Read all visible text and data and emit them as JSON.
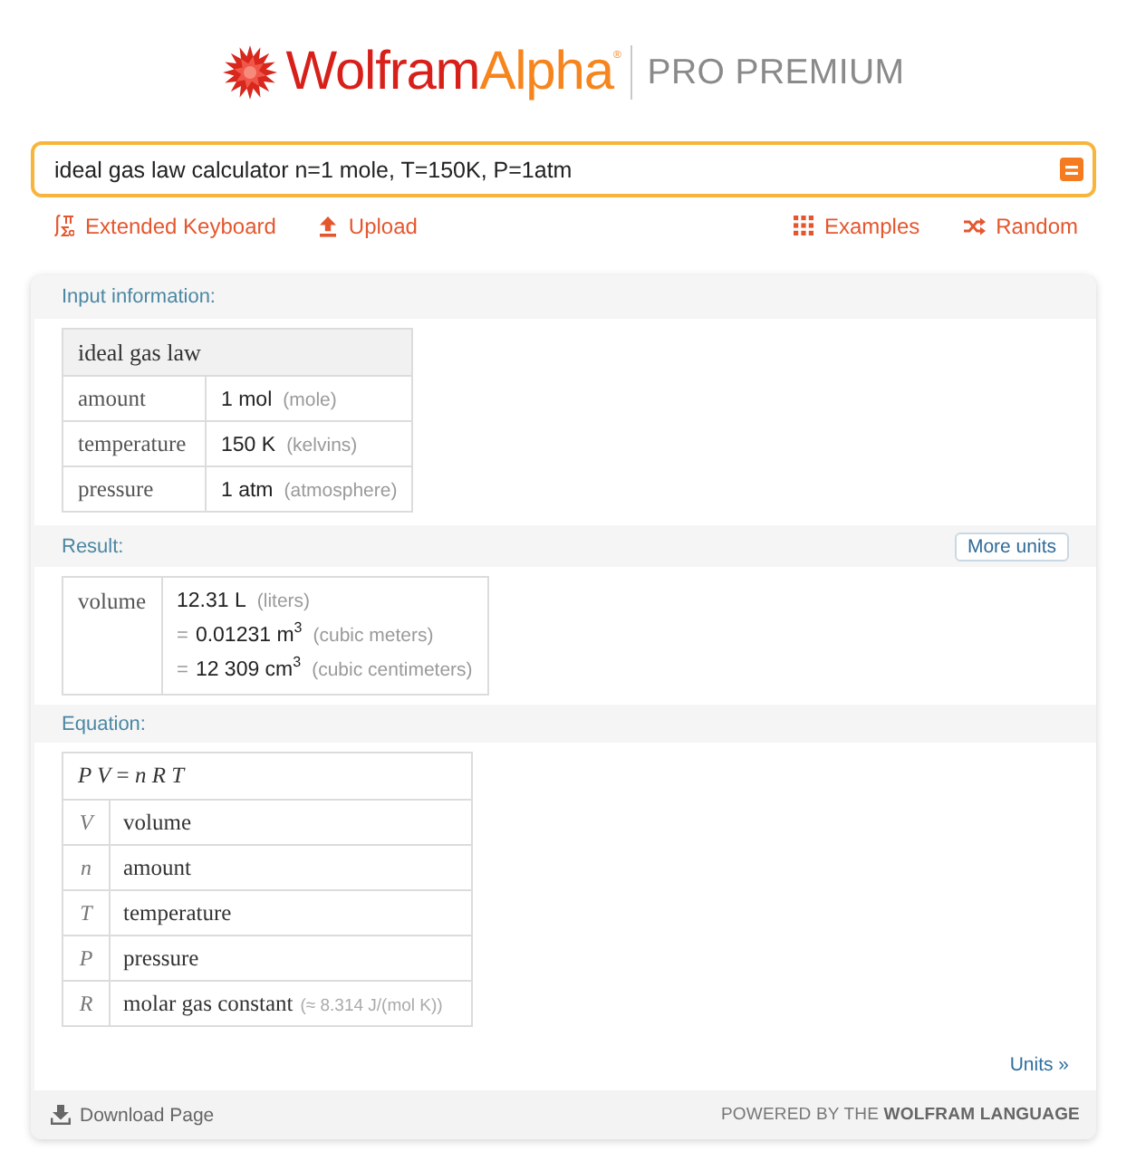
{
  "logo": {
    "primary": "Wolfram",
    "secondary": "Alpha",
    "mark": "®",
    "edition": "PRO PREMIUM"
  },
  "search": {
    "value": "ideal gas law calculator n=1 mole, T=150K, P=1atm"
  },
  "toolbar": {
    "left": [
      {
        "label": "Extended Keyboard",
        "kind": "keyboard"
      },
      {
        "label": "Upload",
        "kind": "upload"
      }
    ],
    "right": [
      {
        "label": "Examples",
        "kind": "examples"
      },
      {
        "label": "Random",
        "kind": "random"
      }
    ]
  },
  "pods": [
    {
      "kind": "input",
      "title": "Input information:",
      "table": {
        "header": "ideal gas law",
        "rows": [
          {
            "label": "amount",
            "value": "1 mol",
            "unit": "(mole)"
          },
          {
            "label": "temperature",
            "value": "150 K",
            "unit": "(kelvins)"
          },
          {
            "label": "pressure",
            "value": "1 atm",
            "unit": "(atmosphere)"
          }
        ]
      }
    },
    {
      "kind": "result",
      "title": "Result:",
      "button": "More units",
      "table": {
        "label": "volume",
        "lines": [
          {
            "value": "12.31 L",
            "unit": "(liters)"
          },
          {
            "prefix": "=",
            "value": "0.01231 m$^{3}$",
            "unit": "(cubic meters)"
          },
          {
            "prefix": "=",
            "value": "12 309 cm$^{3}$",
            "unit": "(cubic centimeters)"
          }
        ]
      }
    },
    {
      "kind": "equation",
      "title": "Equation:",
      "table": {
        "header": "*P V* = *n R T*",
        "rows": [
          {
            "symbol": "V",
            "label": "volume"
          },
          {
            "symbol": "n",
            "label": "amount"
          },
          {
            "symbol": "T",
            "label": "temperature"
          },
          {
            "symbol": "P",
            "label": "pressure"
          },
          {
            "symbol": "R",
            "label": "molar gas constant",
            "note": "(≈ 8.314 J/(mol K))"
          }
        ]
      },
      "link": "Units »"
    }
  ],
  "footer": {
    "download": "Download Page",
    "powered_by": "POWERED BY THE **WOLFRAM LANGUAGE**"
  }
}
